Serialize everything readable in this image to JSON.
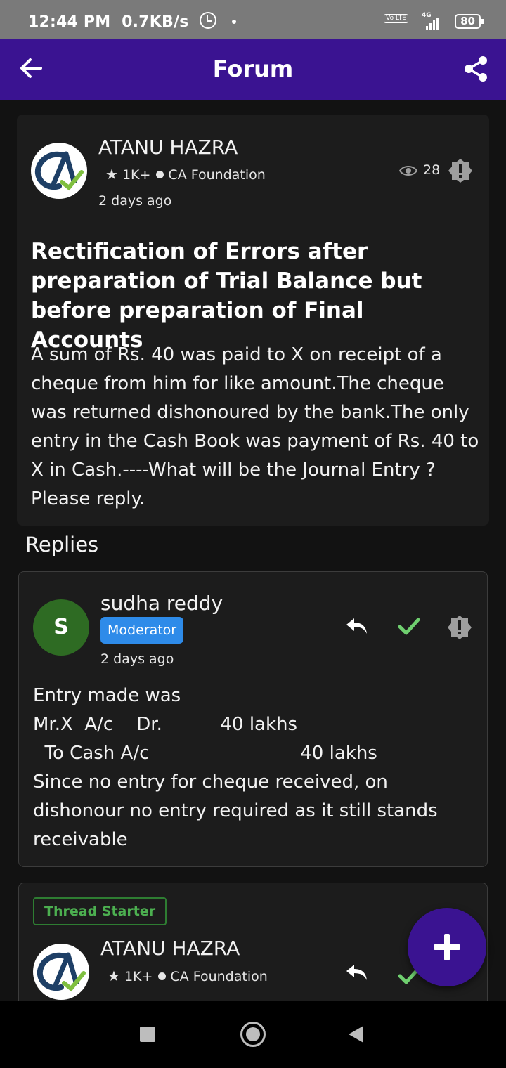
{
  "status_bar": {
    "time": "12:44 PM",
    "speed": "0.7KB/s",
    "volte": "Vo LTE",
    "network": "4G",
    "battery": "80"
  },
  "appbar": {
    "title": "Forum",
    "back_icon": "arrow-left-icon",
    "share_icon": "share-icon"
  },
  "post": {
    "author": "ATANU HAZRA",
    "points": "1K+",
    "course": "CA Foundation",
    "time": "2 days ago",
    "views": "28",
    "title": "Rectification of Errors after preparation of Trial Balance but before preparation of Final Accounts",
    "body": "A sum of Rs. 40 was paid to X on receipt of a cheque from him for like amount.The cheque was returned dishonoured by the bank.The only entry in the Cash Book was payment of Rs. 40 to X in Cash.----What will be the Journal Entry ? Please reply."
  },
  "replies_label": "Replies",
  "reply1": {
    "avatar_letter": "S",
    "author": "sudha reddy",
    "badge": "Moderator",
    "time": "2 days ago",
    "body": "Entry made was\nMr.X  A/c    Dr.          40 lakhs\n  To Cash A/c                          40 lakhs\nSince no entry for cheque received, on\ndishonour no entry required as it still stands\nreceivable"
  },
  "reply2": {
    "badge": "Thread Starter",
    "author": "ATANU HAZRA",
    "points": "1K+",
    "course": "CA Foundation"
  },
  "colors": {
    "primary": "#3a1391",
    "moderator": "#2e8be9",
    "check": "#6fcf6f",
    "thread_starter": "#4caf50"
  }
}
